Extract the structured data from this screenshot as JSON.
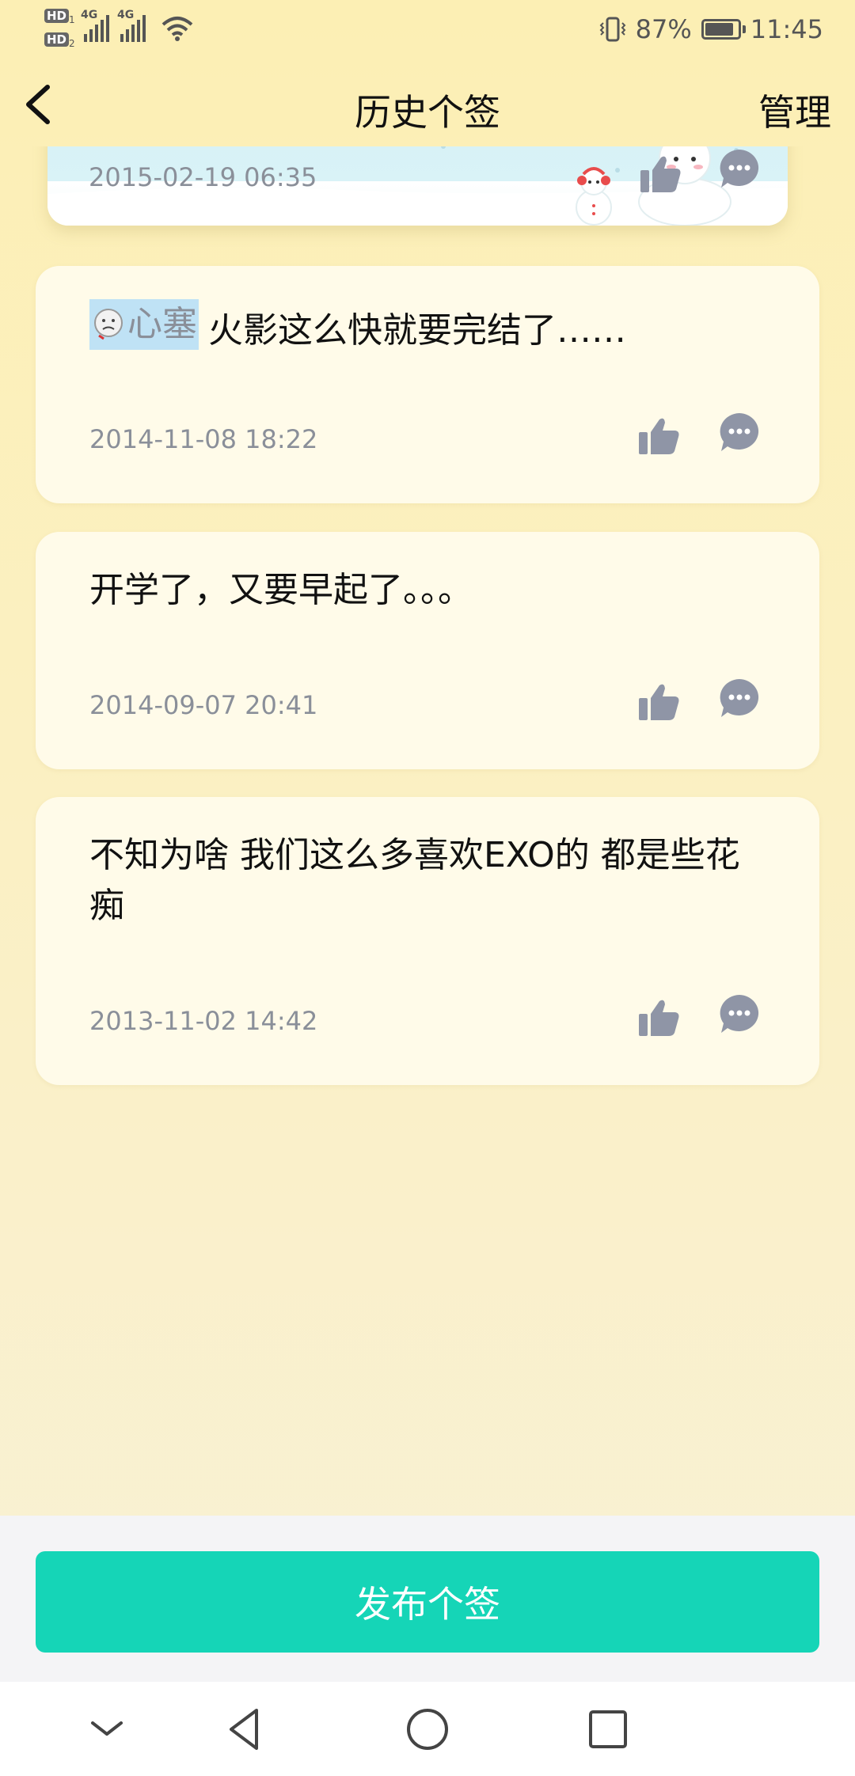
{
  "status_bar": {
    "hd1": "HD",
    "hd1_sub": "1",
    "hd2": "HD",
    "hd2_sub": "2",
    "net1": "4G",
    "net2": "4G",
    "battery_percent_text": "87%",
    "battery_level": 0.87,
    "time": "11:45"
  },
  "header": {
    "title": "历史个签",
    "manage_label": "管理"
  },
  "entries": [
    {
      "date": "2015-02-19 06:35"
    },
    {
      "tag_label": "心塞",
      "text": "火影这么快就要完结了……",
      "date": "2014-11-08 18:22"
    },
    {
      "text": " 开学了，又要早起了。。。",
      "date": "2014-09-07 20:41"
    },
    {
      "text": " 不知为啥 我们这么多喜欢EXO的  都是些花痴",
      "date": "2013-11-02 14:42"
    }
  ],
  "publish_button_label": "发布个签",
  "colors": {
    "accent": "#15d5b7",
    "card_background": "#fffbe9",
    "icon_gray": "#8f95a6",
    "date_gray": "#8a8f99"
  },
  "icons": [
    "back-icon",
    "thumbs-up-icon",
    "comment-bubble-icon",
    "wifi-icon",
    "vibrate-icon",
    "battery-icon",
    "nav-collapse-icon",
    "nav-back-icon",
    "nav-home-icon",
    "nav-recents-icon"
  ]
}
